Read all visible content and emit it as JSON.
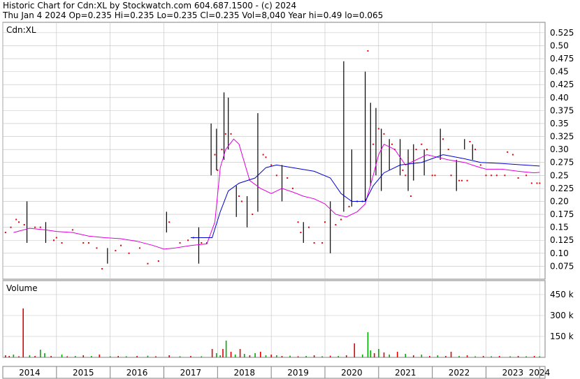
{
  "header": {
    "title": "Historic Chart for Cdn:XL by Stockwatch.com 604.687.1500 - (c) 2024",
    "quote": "Thu Jan  4 2024  Op=0.235  Hi=0.235  Lo=0.235  Cl=0.235  Vol=8,040  Year hi=0.49  lo=0.065"
  },
  "colors": {
    "ma_short": "#e000e0",
    "ma_long": "#0000d0",
    "price_range": "#000000",
    "price_dot": "#e00000",
    "vol_up": "#00aa00",
    "vol_down": "#e00000",
    "grid": "#c0c0c0"
  },
  "chart_data": [
    {
      "type": "line",
      "panel_label": "Cdn:XL",
      "x_ticks": [
        "2014",
        "2015",
        "2016",
        "2017",
        "2018",
        "2019",
        "2020",
        "2021",
        "2022",
        "2023",
        "2024"
      ],
      "y_ticks": [
        "0.525",
        "0.50",
        "0.475",
        "0.45",
        "0.425",
        "0.40",
        "0.375",
        "0.35",
        "0.325",
        "0.30",
        "0.275",
        "0.25",
        "0.225",
        "0.20",
        "0.175",
        "0.15",
        "0.125",
        "0.10",
        "0.075"
      ],
      "ylim": [
        0.05,
        0.545
      ],
      "xlim": [
        2014.0,
        2024.1
      ],
      "series": [
        {
          "key": "ma_short",
          "points": [
            [
              2014.2,
              0.14
            ],
            [
              2014.5,
              0.148
            ],
            [
              2014.8,
              0.145
            ],
            [
              2015.0,
              0.142
            ],
            [
              2015.3,
              0.14
            ],
            [
              2015.6,
              0.133
            ],
            [
              2015.9,
              0.13
            ],
            [
              2016.2,
              0.128
            ],
            [
              2016.5,
              0.123
            ],
            [
              2016.8,
              0.115
            ],
            [
              2017.0,
              0.108
            ],
            [
              2017.2,
              0.11
            ],
            [
              2017.5,
              0.115
            ],
            [
              2017.8,
              0.118
            ],
            [
              2017.95,
              0.16
            ],
            [
              2018.05,
              0.265
            ],
            [
              2018.15,
              0.3
            ],
            [
              2018.3,
              0.32
            ],
            [
              2018.4,
              0.31
            ],
            [
              2018.5,
              0.275
            ],
            [
              2018.6,
              0.24
            ],
            [
              2018.8,
              0.225
            ],
            [
              2019.0,
              0.215
            ],
            [
              2019.2,
              0.225
            ],
            [
              2019.4,
              0.218
            ],
            [
              2019.6,
              0.21
            ],
            [
              2019.8,
              0.205
            ],
            [
              2020.0,
              0.195
            ],
            [
              2020.2,
              0.175
            ],
            [
              2020.4,
              0.17
            ],
            [
              2020.6,
              0.18
            ],
            [
              2020.75,
              0.195
            ],
            [
              2020.9,
              0.25
            ],
            [
              2021.0,
              0.29
            ],
            [
              2021.1,
              0.31
            ],
            [
              2021.3,
              0.3
            ],
            [
              2021.5,
              0.27
            ],
            [
              2021.7,
              0.28
            ],
            [
              2021.9,
              0.29
            ],
            [
              2022.1,
              0.285
            ],
            [
              2022.3,
              0.28
            ],
            [
              2022.6,
              0.275
            ],
            [
              2022.8,
              0.268
            ],
            [
              2023.0,
              0.262
            ],
            [
              2023.3,
              0.262
            ],
            [
              2023.6,
              0.258
            ],
            [
              2023.9,
              0.255
            ],
            [
              2024.0,
              0.256
            ]
          ]
        },
        {
          "key": "ma_long",
          "points": [
            [
              2017.5,
              0.13
            ],
            [
              2017.9,
              0.13
            ],
            [
              2018.05,
              0.18
            ],
            [
              2018.2,
              0.22
            ],
            [
              2018.4,
              0.235
            ],
            [
              2018.7,
              0.245
            ],
            [
              2018.9,
              0.265
            ],
            [
              2019.1,
              0.27
            ],
            [
              2019.4,
              0.265
            ],
            [
              2019.8,
              0.258
            ],
            [
              2020.1,
              0.245
            ],
            [
              2020.3,
              0.215
            ],
            [
              2020.5,
              0.2
            ],
            [
              2020.75,
              0.2
            ],
            [
              2020.9,
              0.23
            ],
            [
              2021.1,
              0.255
            ],
            [
              2021.4,
              0.27
            ],
            [
              2021.8,
              0.275
            ],
            [
              2022.2,
              0.29
            ],
            [
              2022.6,
              0.282
            ],
            [
              2022.9,
              0.275
            ],
            [
              2023.3,
              0.273
            ],
            [
              2023.7,
              0.27
            ],
            [
              2024.0,
              0.268
            ]
          ]
        }
      ],
      "price_ranges": [
        [
          2014.45,
          0.12,
          0.2
        ],
        [
          2014.8,
          0.12,
          0.16
        ],
        [
          2015.95,
          0.08,
          0.11
        ],
        [
          2017.05,
          0.14,
          0.18
        ],
        [
          2017.65,
          0.08,
          0.15
        ],
        [
          2017.88,
          0.25,
          0.35
        ],
        [
          2017.98,
          0.26,
          0.34
        ],
        [
          2018.12,
          0.28,
          0.41
        ],
        [
          2018.2,
          0.3,
          0.4
        ],
        [
          2018.35,
          0.17,
          0.23
        ],
        [
          2018.55,
          0.15,
          0.21
        ],
        [
          2018.75,
          0.18,
          0.37
        ],
        [
          2019.2,
          0.2,
          0.27
        ],
        [
          2019.6,
          0.12,
          0.16
        ],
        [
          2020.1,
          0.1,
          0.2
        ],
        [
          2020.35,
          0.18,
          0.47
        ],
        [
          2020.5,
          0.19,
          0.3
        ],
        [
          2020.75,
          0.2,
          0.45
        ],
        [
          2020.85,
          0.23,
          0.39
        ],
        [
          2020.95,
          0.25,
          0.38
        ],
        [
          2021.05,
          0.22,
          0.34
        ],
        [
          2021.2,
          0.26,
          0.32
        ],
        [
          2021.4,
          0.25,
          0.32
        ],
        [
          2021.55,
          0.22,
          0.3
        ],
        [
          2021.65,
          0.24,
          0.31
        ],
        [
          2021.85,
          0.25,
          0.3
        ],
        [
          2022.15,
          0.28,
          0.34
        ],
        [
          2022.45,
          0.22,
          0.28
        ],
        [
          2022.6,
          0.3,
          0.32
        ],
        [
          2022.75,
          0.28,
          0.31
        ]
      ],
      "price_dots": [
        [
          2014.05,
          0.14
        ],
        [
          2014.15,
          0.15
        ],
        [
          2014.25,
          0.165
        ],
        [
          2014.3,
          0.16
        ],
        [
          2014.4,
          0.155
        ],
        [
          2014.6,
          0.15
        ],
        [
          2014.7,
          0.15
        ],
        [
          2014.95,
          0.125
        ],
        [
          2015.0,
          0.13
        ],
        [
          2015.1,
          0.12
        ],
        [
          2015.3,
          0.145
        ],
        [
          2015.5,
          0.12
        ],
        [
          2015.6,
          0.12
        ],
        [
          2015.75,
          0.11
        ],
        [
          2015.85,
          0.07
        ],
        [
          2016.1,
          0.105
        ],
        [
          2016.2,
          0.115
        ],
        [
          2016.35,
          0.1
        ],
        [
          2016.55,
          0.11
        ],
        [
          2016.7,
          0.08
        ],
        [
          2016.9,
          0.085
        ],
        [
          2017.1,
          0.16
        ],
        [
          2017.3,
          0.12
        ],
        [
          2017.45,
          0.125
        ],
        [
          2017.55,
          0.13
        ],
        [
          2017.7,
          0.12
        ],
        [
          2017.8,
          0.12
        ],
        [
          2017.95,
          0.29
        ],
        [
          2018.0,
          0.26
        ],
        [
          2018.08,
          0.3
        ],
        [
          2018.15,
          0.33
        ],
        [
          2018.25,
          0.33
        ],
        [
          2018.4,
          0.21
        ],
        [
          2018.45,
          0.2
        ],
        [
          2018.65,
          0.175
        ],
        [
          2018.85,
          0.29
        ],
        [
          2018.9,
          0.285
        ],
        [
          2019.0,
          0.27
        ],
        [
          2019.1,
          0.25
        ],
        [
          2019.3,
          0.245
        ],
        [
          2019.4,
          0.225
        ],
        [
          2019.5,
          0.16
        ],
        [
          2019.55,
          0.14
        ],
        [
          2019.7,
          0.15
        ],
        [
          2019.8,
          0.12
        ],
        [
          2019.95,
          0.12
        ],
        [
          2020.0,
          0.16
        ],
        [
          2020.2,
          0.155
        ],
        [
          2020.3,
          0.165
        ],
        [
          2020.45,
          0.19
        ],
        [
          2020.6,
          0.2
        ],
        [
          2020.7,
          0.2
        ],
        [
          2020.8,
          0.49
        ],
        [
          2020.9,
          0.31
        ],
        [
          2021.0,
          0.34
        ],
        [
          2021.1,
          0.33
        ],
        [
          2021.25,
          0.31
        ],
        [
          2021.3,
          0.3
        ],
        [
          2021.45,
          0.26
        ],
        [
          2021.5,
          0.25
        ],
        [
          2021.6,
          0.21
        ],
        [
          2021.7,
          0.3
        ],
        [
          2021.8,
          0.31
        ],
        [
          2021.9,
          0.3
        ],
        [
          2022.0,
          0.25
        ],
        [
          2022.05,
          0.25
        ],
        [
          2022.2,
          0.32
        ],
        [
          2022.3,
          0.3
        ],
        [
          2022.35,
          0.25
        ],
        [
          2022.5,
          0.24
        ],
        [
          2022.55,
          0.24
        ],
        [
          2022.65,
          0.24
        ],
        [
          2022.7,
          0.315
        ],
        [
          2022.8,
          0.3
        ],
        [
          2022.9,
          0.27
        ],
        [
          2023.0,
          0.25
        ],
        [
          2023.1,
          0.25
        ],
        [
          2023.2,
          0.25
        ],
        [
          2023.35,
          0.25
        ],
        [
          2023.4,
          0.295
        ],
        [
          2023.5,
          0.29
        ],
        [
          2023.6,
          0.245
        ],
        [
          2023.75,
          0.25
        ],
        [
          2023.85,
          0.235
        ],
        [
          2023.95,
          0.235
        ],
        [
          2024.0,
          0.235
        ]
      ]
    },
    {
      "type": "bar",
      "panel_label": "Volume",
      "y_ticks": [
        "450 k",
        "300 k",
        "150 k"
      ],
      "ylim": [
        0,
        550
      ],
      "bars_k": [
        [
          2014.05,
          15,
          "down"
        ],
        [
          2014.12,
          10,
          "down"
        ],
        [
          2014.2,
          20,
          "up"
        ],
        [
          2014.3,
          8,
          "down"
        ],
        [
          2014.38,
          350,
          "down"
        ],
        [
          2014.5,
          15,
          "up"
        ],
        [
          2014.6,
          10,
          "down"
        ],
        [
          2014.7,
          55,
          "up"
        ],
        [
          2014.78,
          30,
          "up"
        ],
        [
          2014.9,
          10,
          "down"
        ],
        [
          2015.1,
          20,
          "up"
        ],
        [
          2015.2,
          8,
          "down"
        ],
        [
          2015.35,
          10,
          "up"
        ],
        [
          2015.5,
          15,
          "down"
        ],
        [
          2015.65,
          10,
          "up"
        ],
        [
          2015.8,
          20,
          "down"
        ],
        [
          2016.0,
          8,
          "up"
        ],
        [
          2016.15,
          10,
          "down"
        ],
        [
          2016.3,
          8,
          "up"
        ],
        [
          2016.5,
          10,
          "down"
        ],
        [
          2016.7,
          12,
          "up"
        ],
        [
          2016.85,
          8,
          "down"
        ],
        [
          2017.1,
          15,
          "down"
        ],
        [
          2017.3,
          8,
          "up"
        ],
        [
          2017.5,
          10,
          "down"
        ],
        [
          2017.7,
          8,
          "up"
        ],
        [
          2017.9,
          60,
          "down"
        ],
        [
          2017.98,
          30,
          "up"
        ],
        [
          2018.05,
          15,
          "up"
        ],
        [
          2018.1,
          60,
          "down"
        ],
        [
          2018.16,
          120,
          "up"
        ],
        [
          2018.25,
          40,
          "down"
        ],
        [
          2018.33,
          20,
          "up"
        ],
        [
          2018.42,
          60,
          "down"
        ],
        [
          2018.5,
          25,
          "up"
        ],
        [
          2018.6,
          15,
          "down"
        ],
        [
          2018.7,
          30,
          "up"
        ],
        [
          2018.8,
          40,
          "down"
        ],
        [
          2018.9,
          15,
          "up"
        ],
        [
          2019.0,
          20,
          "down"
        ],
        [
          2019.1,
          15,
          "up"
        ],
        [
          2019.2,
          10,
          "down"
        ],
        [
          2019.35,
          12,
          "up"
        ],
        [
          2019.5,
          8,
          "down"
        ],
        [
          2019.65,
          10,
          "up"
        ],
        [
          2019.8,
          15,
          "down"
        ],
        [
          2019.95,
          8,
          "up"
        ],
        [
          2020.1,
          12,
          "down"
        ],
        [
          2020.25,
          10,
          "up"
        ],
        [
          2020.4,
          15,
          "down"
        ],
        [
          2020.55,
          100,
          "down"
        ],
        [
          2020.7,
          20,
          "up"
        ],
        [
          2020.8,
          180,
          "up"
        ],
        [
          2020.85,
          50,
          "up"
        ],
        [
          2020.92,
          30,
          "down"
        ],
        [
          2021.0,
          60,
          "up"
        ],
        [
          2021.1,
          35,
          "down"
        ],
        [
          2021.2,
          20,
          "up"
        ],
        [
          2021.35,
          40,
          "down"
        ],
        [
          2021.5,
          25,
          "up"
        ],
        [
          2021.65,
          15,
          "down"
        ],
        [
          2021.8,
          20,
          "up"
        ],
        [
          2021.95,
          10,
          "down"
        ],
        [
          2022.1,
          15,
          "up"
        ],
        [
          2022.25,
          10,
          "down"
        ],
        [
          2022.35,
          40,
          "down"
        ],
        [
          2022.5,
          10,
          "up"
        ],
        [
          2022.65,
          15,
          "down"
        ],
        [
          2022.8,
          8,
          "up"
        ],
        [
          2022.95,
          10,
          "down"
        ],
        [
          2023.1,
          8,
          "up"
        ],
        [
          2023.25,
          10,
          "down"
        ],
        [
          2023.45,
          8,
          "up"
        ],
        [
          2023.6,
          10,
          "down"
        ],
        [
          2023.75,
          8,
          "up"
        ],
        [
          2023.9,
          10,
          "down"
        ],
        [
          2024.0,
          8,
          "up"
        ]
      ]
    }
  ]
}
